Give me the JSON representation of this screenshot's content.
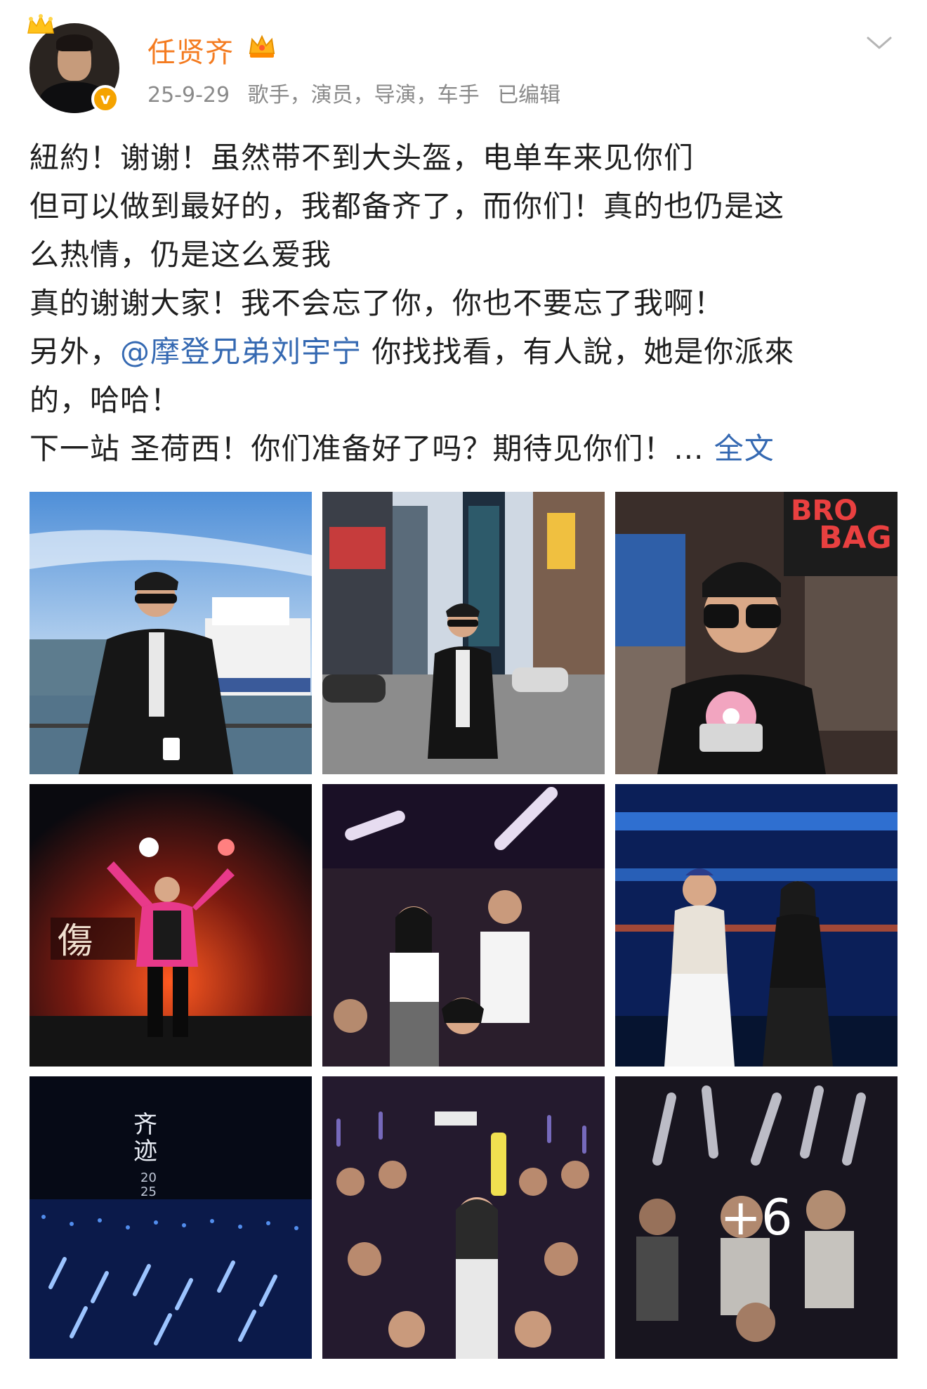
{
  "header": {
    "username": "任贤齐",
    "date": "25-9-29",
    "tags": "歌手，演员，导演，车手",
    "edited": "已编辑"
  },
  "post": {
    "lines": [
      "紐約！谢谢！虽然带不到大头盔，电单车来见你们",
      "但可以做到最好的，我都备齐了，而你们！真的也仍是这",
      "么热情，仍是这么爱我",
      "真的谢谢大家！我不会忘了你，你也不要忘了我啊！"
    ],
    "line5_prefix": "另外，",
    "mention": "@摩登兄弟刘宇宁",
    "line5_suffix": " 你找找看，有人說，她是你派來",
    "line6": "的，哈哈！",
    "line7": "下一站 圣荷西！你们准备好了吗？期待见你们！... ",
    "more_label": "全文"
  },
  "photos": {
    "overflow_count": "+6"
  },
  "colors": {
    "username": "#f47b20",
    "link": "#3569b2",
    "meta": "#8a8a8a",
    "verified": "#f5a300"
  }
}
